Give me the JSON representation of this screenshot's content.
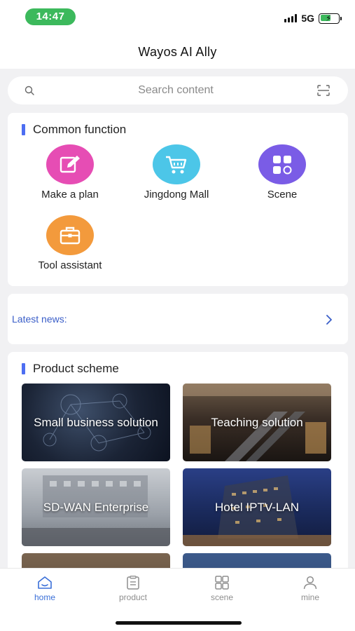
{
  "status": {
    "time": "14:47",
    "network": "5G"
  },
  "header": {
    "title": "Wayos AI Ally"
  },
  "search": {
    "placeholder": "Search content"
  },
  "common": {
    "title": "Common function",
    "items": [
      {
        "label": "Make a plan",
        "icon": "edit-icon",
        "color": "#e64db4"
      },
      {
        "label": "Jingdong Mall",
        "icon": "cart-icon",
        "color": "#4cc6e8"
      },
      {
        "label": "Scene",
        "icon": "grid-icon",
        "color": "#7a5ce6"
      },
      {
        "label": "Tool assistant",
        "icon": "toolbox-icon",
        "color": "#f39a3c"
      }
    ]
  },
  "news": {
    "label": "Latest news:"
  },
  "product": {
    "title": "Product scheme",
    "tiles": [
      {
        "label": "Small business solution"
      },
      {
        "label": "Teaching solution"
      },
      {
        "label": "SD-WAN Enterprise"
      },
      {
        "label": "Hotel IPTV-LAN"
      }
    ]
  },
  "tabs": [
    {
      "label": "home",
      "icon": "home-icon",
      "active": true
    },
    {
      "label": "product",
      "icon": "clipboard-icon",
      "active": false
    },
    {
      "label": "scene",
      "icon": "grid-icon",
      "active": false
    },
    {
      "label": "mine",
      "icon": "user-icon",
      "active": false
    }
  ],
  "colors": {
    "accent": "#4d6ef2",
    "tab_active": "#3a6fd8",
    "status_pill": "#3cb95c"
  }
}
